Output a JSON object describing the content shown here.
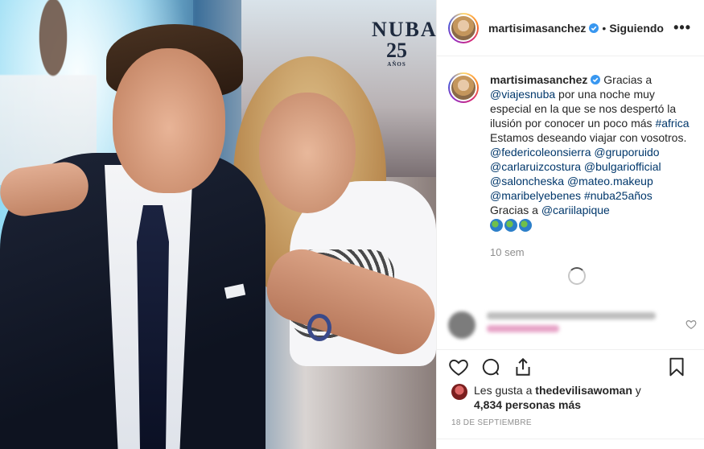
{
  "photo": {
    "sign_word": "NUBA",
    "sign_number": "25",
    "sign_small": "AÑOS"
  },
  "header": {
    "username": "martisimasanchez",
    "separator": "•",
    "follow_state": "Siguiendo",
    "more_label": "•••"
  },
  "caption": {
    "username": "martisimasanchez",
    "text_1": "Gracias a ",
    "mention_1": "@viajesnuba",
    "text_2": " por una noche muy especial en la que se nos despertó la ilusión por conocer un poco más ",
    "hashtag_1": "#africa",
    "text_3": " Estamos deseando viajar con vosotros. ",
    "mention_2": "@federicoleonsierra",
    "mention_3": "@gruporuido",
    "mention_4": "@carlaruizcostura",
    "mention_5": "@bulgariofficial",
    "mention_6": "@saloncheska",
    "mention_7": "@mateo.makeup",
    "mention_8": "@maribelyebenes",
    "hashtag_2": "#nuba25años",
    "text_4": " Gracias a ",
    "mention_9": "@cariilapique",
    "time_ago": "10 sem"
  },
  "likes": {
    "prefix": "Les gusta a ",
    "user": "thedevilisawoman",
    "joiner": " y",
    "count": "4,834 personas más"
  },
  "post_date": "18 DE SEPTIEMBRE",
  "colors": {
    "accent_link": "#00376b",
    "verified": "#3897f0",
    "muted": "#8e8e8e"
  }
}
